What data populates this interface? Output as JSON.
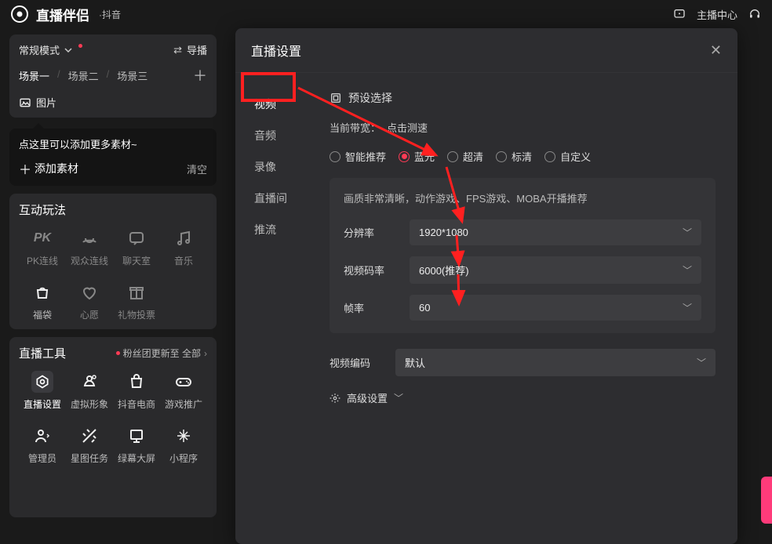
{
  "topbar": {
    "app_name": "直播伴侣",
    "app_sub": "·抖音",
    "anchor_center": "主播中心"
  },
  "sidebar": {
    "mode_label": "常规模式",
    "guide_label": "导播",
    "scenes": [
      "场景一",
      "场景二",
      "场景三"
    ],
    "image_label": "图片",
    "tooltip": "点这里可以添加更多素材~",
    "add_material": "添加素材",
    "clear": "清空",
    "interactive_title": "互动玩法",
    "interactive_items": [
      {
        "label": "PK连线"
      },
      {
        "label": "观众连线"
      },
      {
        "label": "聊天室"
      },
      {
        "label": "音乐"
      },
      {
        "label": "福袋"
      },
      {
        "label": "心愿"
      },
      {
        "label": "礼物投票"
      }
    ],
    "tools_title": "直播工具",
    "fans_update": "粉丝团更新至 全部",
    "tool_items": [
      {
        "label": "直播设置"
      },
      {
        "label": "虚拟形象"
      },
      {
        "label": "抖音电商"
      },
      {
        "label": "游戏推广"
      },
      {
        "label": "管理员"
      },
      {
        "label": "星图任务"
      },
      {
        "label": "绿幕大屏"
      },
      {
        "label": "小程序"
      }
    ]
  },
  "modal": {
    "title": "直播设置",
    "nav": [
      "视频",
      "音频",
      "录像",
      "直播间",
      "推流"
    ],
    "preset_label": "预设选择",
    "bandwidth_label": "当前带宽：",
    "bandwidth_action": "点击测速",
    "quality_options": [
      "智能推荐",
      "蓝光",
      "超清",
      "标清",
      "自定义"
    ],
    "quality_selected_index": 1,
    "quality_desc": "画质非常清晰，动作游戏、FPS游戏、MOBA开播推荐",
    "fields": {
      "resolution_label": "分辨率",
      "resolution_value": "1920*1080",
      "bitrate_label": "视频码率",
      "bitrate_value": "6000(推荐)",
      "fps_label": "帧率",
      "fps_value": "60"
    },
    "encoding_label": "视频编码",
    "encoding_value": "默认",
    "advanced_label": "高级设置"
  }
}
